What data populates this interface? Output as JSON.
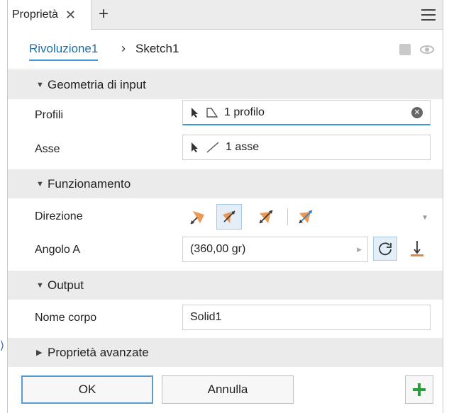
{
  "tabs": {
    "active_label": "Proprietà",
    "close_glyph": "✕",
    "add_glyph": "+"
  },
  "breadcrumb": {
    "item1": "Rivoluzione1",
    "separator": "›",
    "item2": "Sketch1"
  },
  "sections": {
    "input": {
      "label": "Geometria di input",
      "expanded": true
    },
    "funzionamento": {
      "label": "Funzionamento",
      "expanded": true
    },
    "output": {
      "label": "Output",
      "expanded": true
    },
    "advanced": {
      "label": "Proprietà avanzate",
      "expanded": false
    }
  },
  "fields": {
    "profili": {
      "label": "Profili",
      "value": "1 profilo"
    },
    "asse": {
      "label": "Asse",
      "value": "1 asse"
    },
    "direzione": {
      "label": "Direzione",
      "selected_index": 1
    },
    "angolo": {
      "label": "Angolo A",
      "value": "(360,00 gr)"
    },
    "nome_corpo": {
      "label": "Nome corpo",
      "value": "Solid1"
    }
  },
  "buttons": {
    "ok": "OK",
    "cancel": "Annulla",
    "add_glyph": "+"
  },
  "colors": {
    "accent": "#3d9ad7",
    "link": "#1a6fa8",
    "add_green": "#2a9d3a",
    "orange": "#e8873a"
  }
}
